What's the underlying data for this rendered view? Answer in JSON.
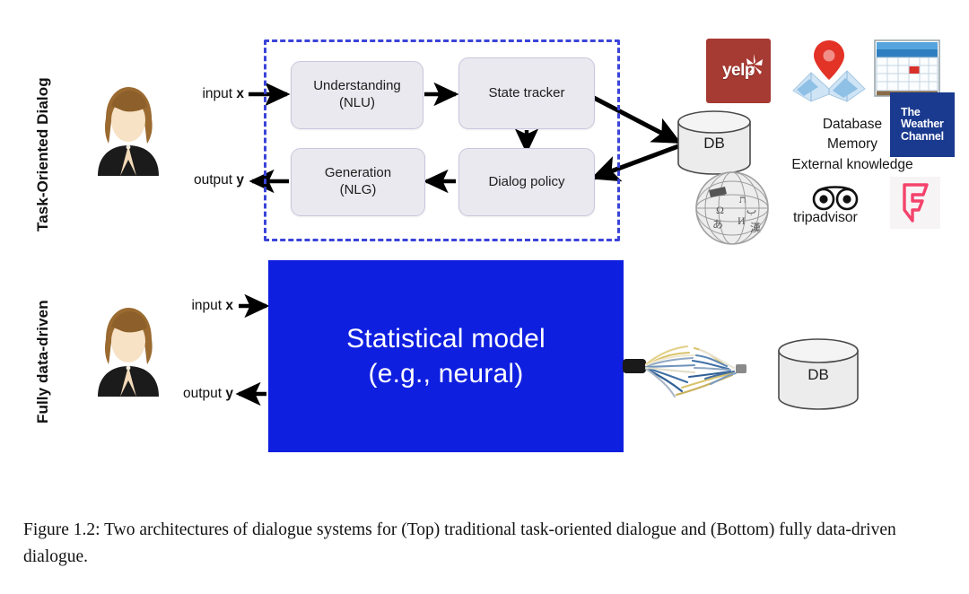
{
  "figure": {
    "caption": "Figure 1.2: Two architectures of dialogue systems for (Top) traditional task-oriented dialogue and (Bottom) fully data-driven dialogue."
  },
  "sections": {
    "top": {
      "side_label": "Task-Oriented Dialog",
      "input_label_text": "input ",
      "input_label_var": "x",
      "output_label_text": "output ",
      "output_label_var": "y",
      "user_icon": "user-avatar-icon",
      "nodes": [
        {
          "id": "nlu",
          "line1": "Understanding",
          "line2": "(NLU)"
        },
        {
          "id": "state-tracker",
          "line1": "State tracker",
          "line2": ""
        },
        {
          "id": "nlg",
          "line1": "Generation",
          "line2": "(NLG)"
        },
        {
          "id": "dialog-policy",
          "line1": "Dialog policy",
          "line2": ""
        }
      ],
      "db_label": "DB",
      "knowledge_lines": [
        "Database",
        "Memory",
        "External knowledge"
      ],
      "logos": [
        {
          "id": "yelp",
          "name": "yelp-logo",
          "text": "yelp"
        },
        {
          "id": "maps",
          "name": "map-icon",
          "text": ""
        },
        {
          "id": "calendar",
          "name": "calendar-icon",
          "text": ""
        },
        {
          "id": "weather-channel",
          "name": "weather-channel-logo",
          "line1": "The",
          "line2": "Weather",
          "line3": "Channel"
        },
        {
          "id": "wikipedia",
          "name": "wikipedia-globe-icon",
          "text": ""
        },
        {
          "id": "tripadvisor",
          "name": "tripadvisor-logo",
          "text": "tripadvisor"
        },
        {
          "id": "foursquare",
          "name": "foursquare-logo",
          "text": ""
        }
      ]
    },
    "bottom": {
      "side_label": "Fully data-driven",
      "input_label_text": "input ",
      "input_label_var": "x",
      "output_label_text": "output ",
      "output_label_var": "y",
      "user_icon": "user-avatar-icon",
      "model_line1": "Statistical model",
      "model_line2": "(e.g., neural)",
      "db_label": "DB",
      "cable_icon": "frayed-cable-icon"
    }
  },
  "colors": {
    "dashed_border": "#3a44d8",
    "model_block": "#0f1fe0",
    "node_fill": "#e9e9ef",
    "node_border": "#c9c7dd",
    "yelp_red": "#a63b33",
    "weather_navy": "#1a3a8f",
    "foursquare_pink": "#f4436c",
    "arrow_black": "#000000",
    "page_background": "#ffffff"
  }
}
